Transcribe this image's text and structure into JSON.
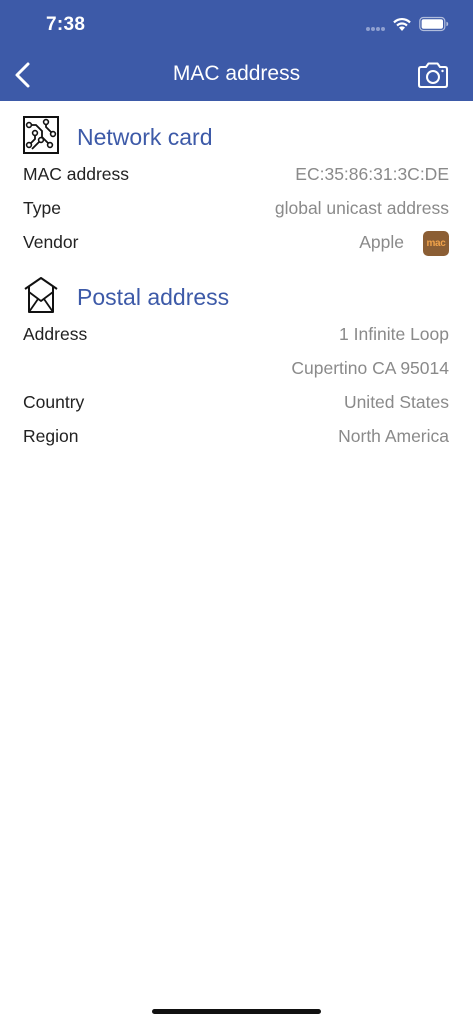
{
  "status_bar": {
    "time": "7:38"
  },
  "nav": {
    "title": "MAC address",
    "back_icon": "chevron-left-icon",
    "camera_icon": "camera-icon"
  },
  "colors": {
    "header_bg": "#3d5aa8",
    "accent": "#3d5aa8",
    "value_text": "#8a8a8a",
    "label_text": "#222222",
    "mac_badge_bg": "#8b5e34",
    "mac_badge_text": "#f0a24a"
  },
  "network_card": {
    "title": "Network card",
    "icon": "circuit-board-icon",
    "rows": [
      {
        "label": "MAC address",
        "value": "EC:35:86:31:3C:DE"
      },
      {
        "label": "Type",
        "value": "global unicast address"
      },
      {
        "label": "Vendor",
        "value": "Apple",
        "badge": "mac"
      }
    ]
  },
  "postal_address": {
    "title": "Postal address",
    "icon": "mail-envelope-house-icon",
    "rows": [
      {
        "label": "Address",
        "value": "1 Infinite Loop"
      },
      {
        "label": "",
        "value": "Cupertino CA 95014"
      },
      {
        "label": "Country",
        "value": "United States"
      },
      {
        "label": "Region",
        "value": "North America"
      }
    ]
  }
}
